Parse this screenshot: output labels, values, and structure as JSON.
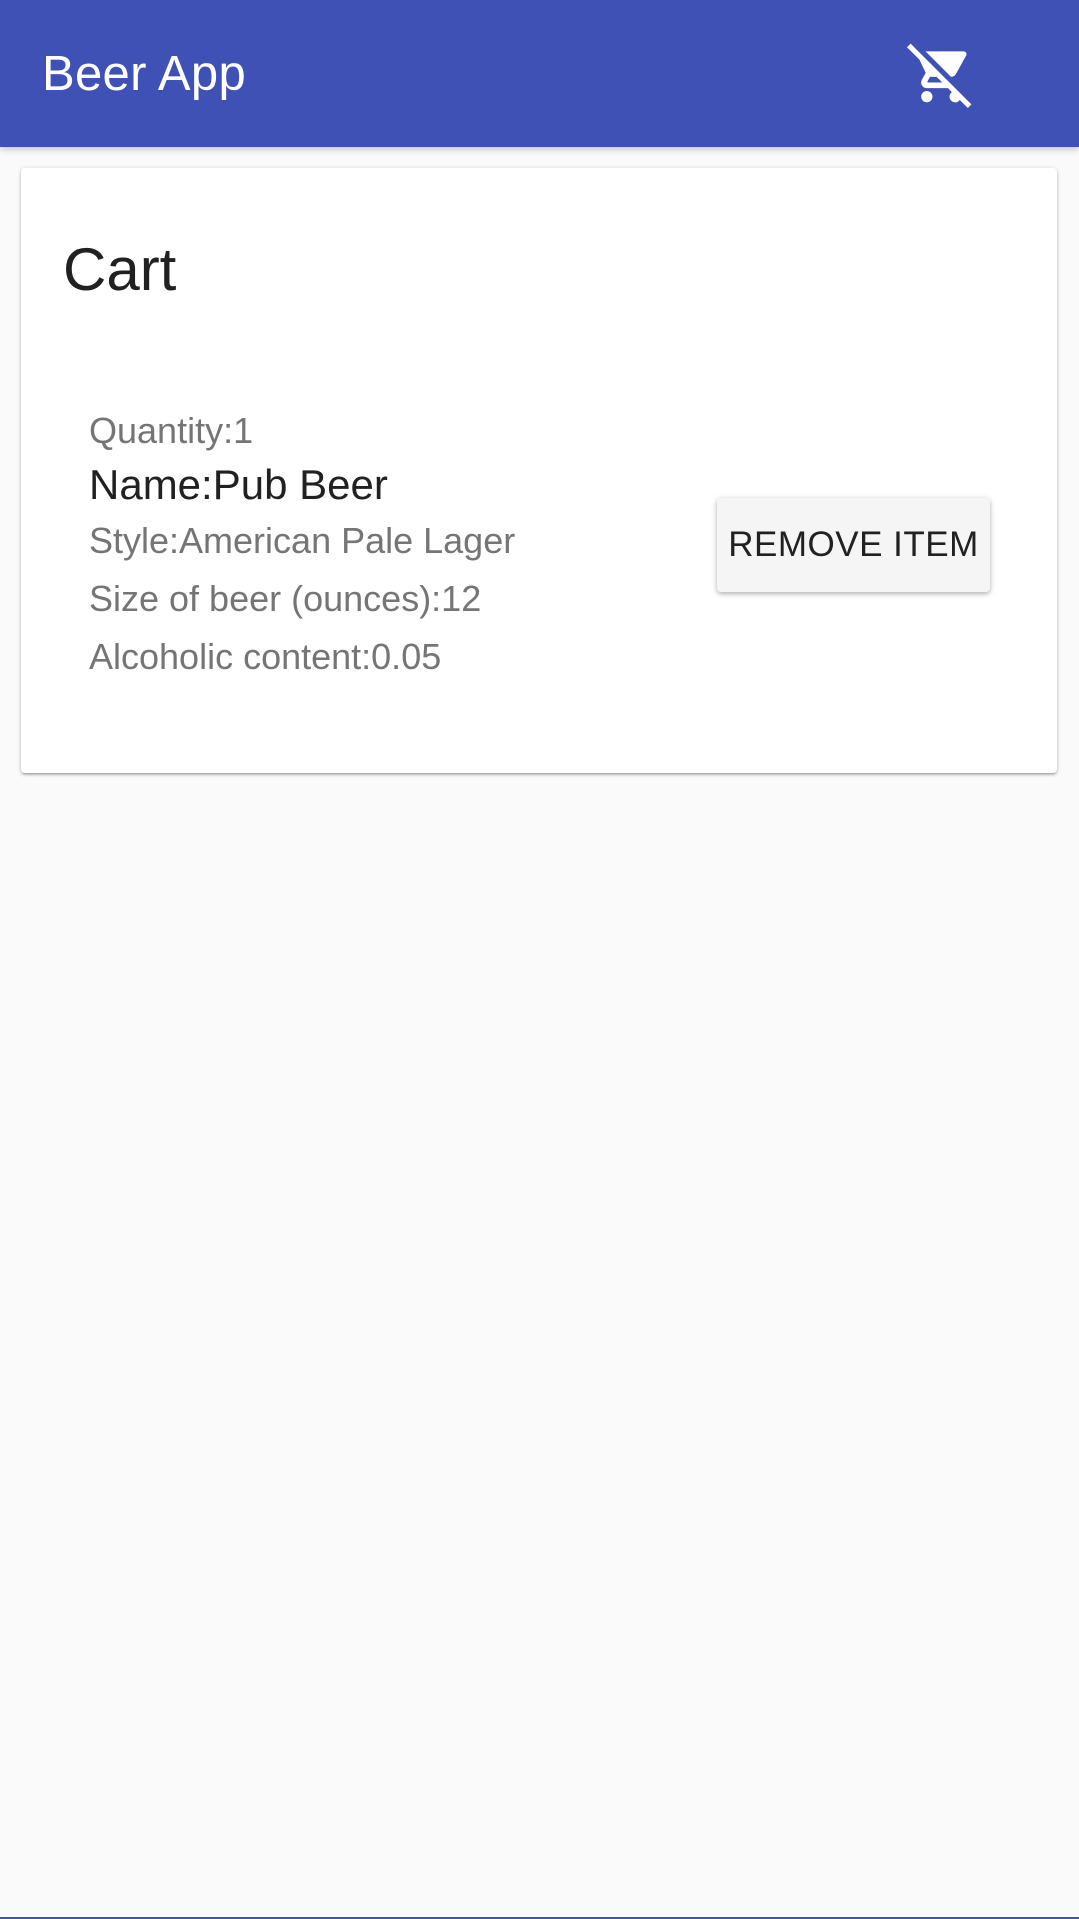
{
  "app": {
    "title": "Beer App",
    "cart_icon": "remove-shopping-cart-icon",
    "accent_color": "#3f51b5"
  },
  "cart": {
    "title": "Cart",
    "items": [
      {
        "quantity": "Quantity:1",
        "name": "Name:Pub Beer",
        "style": "Style:American Pale Lager",
        "size": "Size of beer (ounces):12",
        "alcohol": "Alcoholic content:0.05",
        "remove_label": "REMOVE ITEM"
      }
    ]
  }
}
